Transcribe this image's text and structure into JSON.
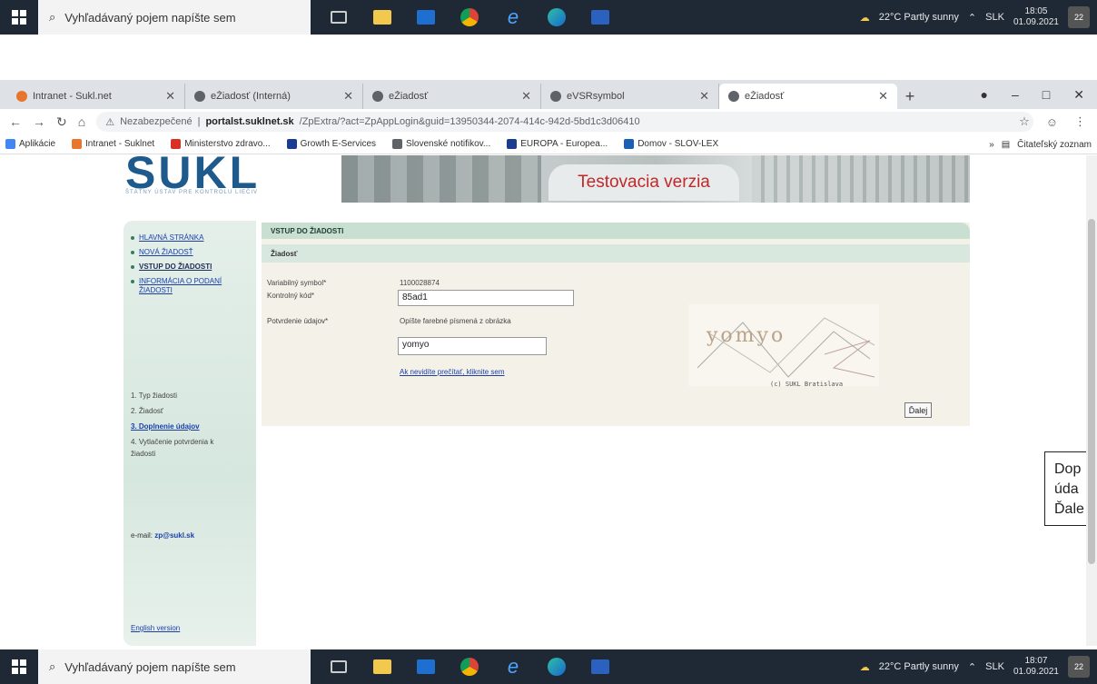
{
  "taskbar": {
    "search_placeholder": "Vyhľadávaný pojem napíšte sem",
    "weather": "22°C Partly sunny",
    "lang": "SLK",
    "top_time": "18:05",
    "top_date": "01.09.2021",
    "bottom_time": "18:07",
    "bottom_date": "01.09.2021",
    "badge": "22"
  },
  "browser": {
    "tabs": [
      {
        "title": "Intranet - Sukl.net",
        "color": "#e7752b"
      },
      {
        "title": "eŽiadosť (Interná)",
        "color": "#5f6368"
      },
      {
        "title": "eŽiadosť",
        "color": "#5f6368"
      },
      {
        "title": "eVSRsymbol",
        "color": "#5f6368"
      },
      {
        "title": "eŽiadosť",
        "color": "#5f6368"
      }
    ],
    "active_tab_index": 4,
    "security_label": "Nezabezpečené",
    "url_host": "portalst.suklnet.sk",
    "url_path": "/ZpExtra/?act=ZpAppLogin&guid=13950344-2074-414c-942d-5bd1c3d06410",
    "bookmarks": [
      {
        "label": "Aplikácie",
        "color": "#4285f4"
      },
      {
        "label": "Intranet - Suklnet",
        "color": "#e7752b"
      },
      {
        "label": "Ministerstvo zdravo...",
        "color": "#d93025"
      },
      {
        "label": "Growth E-Services",
        "color": "#1a3d8f"
      },
      {
        "label": "Slovenské notifikov...",
        "color": "#5f6368"
      },
      {
        "label": "EUROPA - Europea...",
        "color": "#1a3d8f"
      },
      {
        "label": "Domov - SLOV-LEX",
        "color": "#1a5fb4"
      }
    ],
    "reading_list": "Čitateľský zoznam"
  },
  "site": {
    "logo": "SUKL",
    "logo_sub": "ŠTÁTNY ÚSTAV PRE KONTROLU LIEČIV",
    "banner_label": "Testovacia verzia",
    "nav": [
      {
        "label": "HLAVNÁ STRÁNKA",
        "current": false
      },
      {
        "label": "NOVÁ ŽIADOSŤ",
        "current": false
      },
      {
        "label": "VSTUP DO ŽIADOSTI",
        "current": true
      },
      {
        "label": "INFORMÁCIA O PODANÍ ŽIADOSTI",
        "current": false
      }
    ],
    "steps": [
      {
        "label": "1. Typ žiadosti",
        "active": false
      },
      {
        "label": "2. Žiadosť",
        "active": false
      },
      {
        "label": "3. Doplnenie údajov",
        "active": true
      },
      {
        "label": "4. Vytlačenie potvrdenia k žiadosti",
        "active": false
      }
    ],
    "email_label": "e-mail:",
    "email_value": "zp@sukl.sk",
    "english_link": "English version"
  },
  "form": {
    "panel_title": "VSTUP DO ŽIADOSTI",
    "section_title": "Žiadosť",
    "variable_symbol_label": "Variabilný symbol*",
    "variable_symbol_value": "1100028874",
    "control_code_label": "Kontrolný kód*",
    "control_code_value": "85ad1",
    "confirm_label": "Potvrdenie údajov*",
    "captcha_instruction": "Opíšte farebné písmená z obrázka",
    "captcha_value": "yomyo",
    "captcha_refresh_link": "Ak nevidíte prečítať, kliknite sem",
    "captcha_image_text": "yomyo",
    "captcha_credit": "(c) SUKL Bratislava",
    "next_button": "Ďalej"
  },
  "callout": {
    "line1": "Dop",
    "line2": "úda",
    "line3": "Ďale"
  }
}
